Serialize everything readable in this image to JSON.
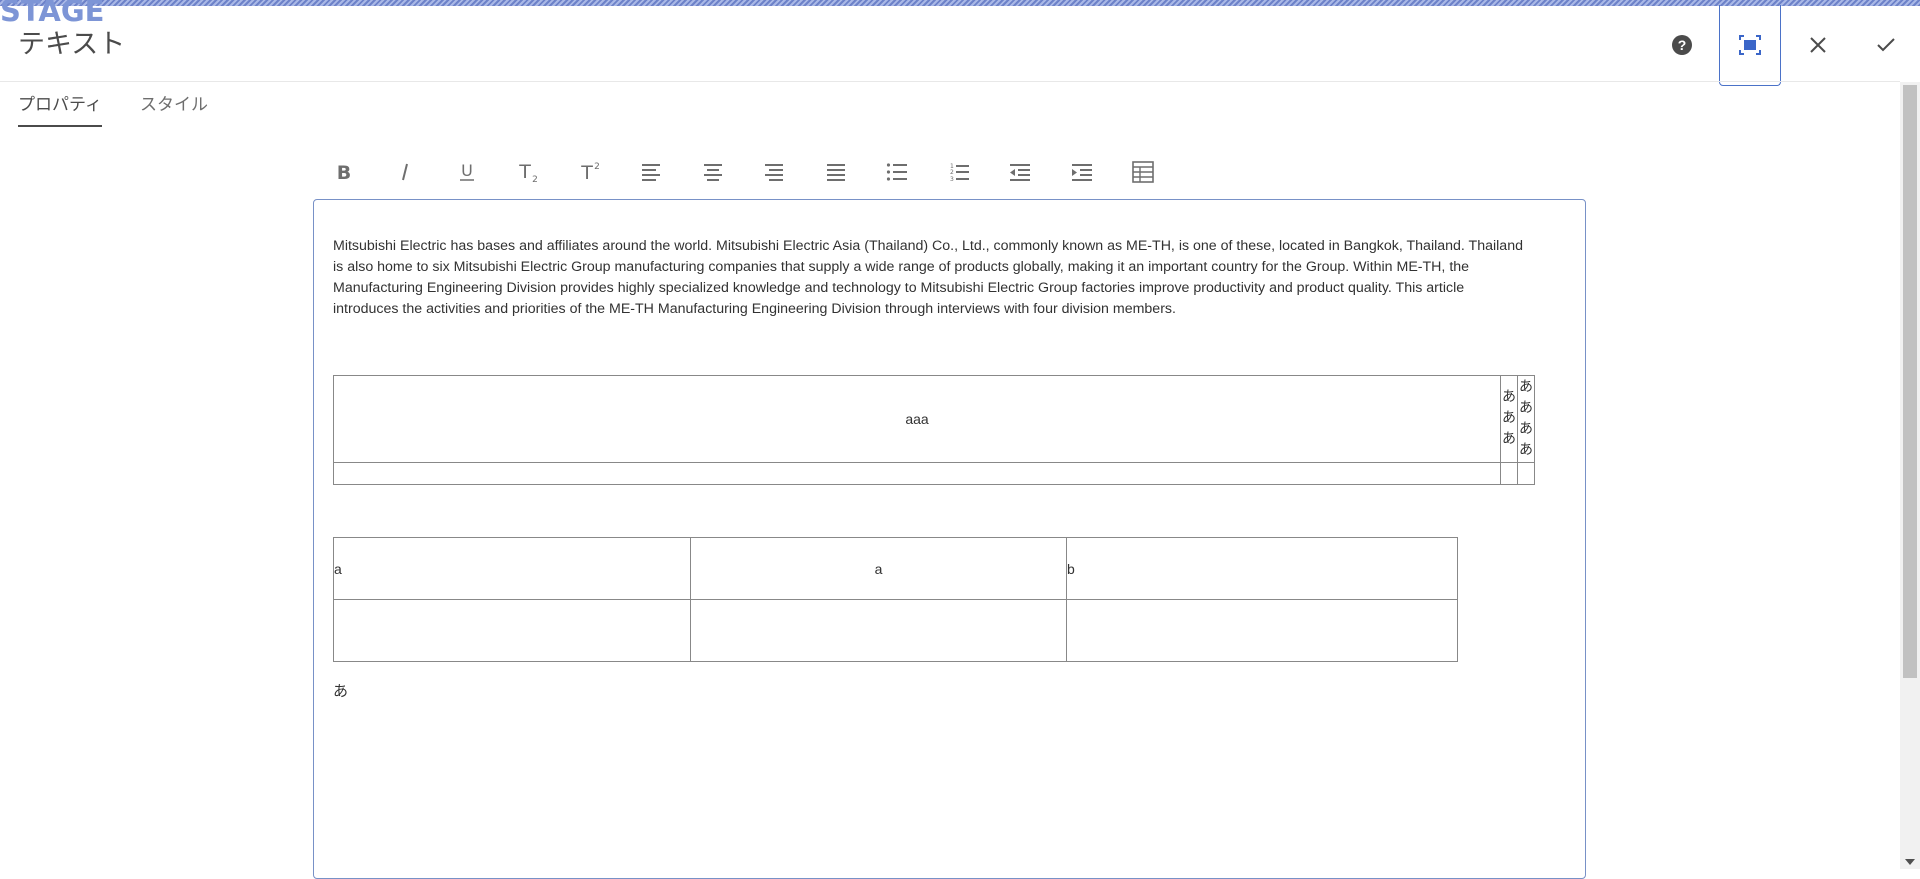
{
  "environment": {
    "label": "STAGE"
  },
  "dialog": {
    "title": "テキスト"
  },
  "header": {
    "help_icon": "help-circle-icon",
    "fullscreen_icon": "fullscreen-icon",
    "close_icon": "close-icon",
    "done_icon": "checkmark-icon"
  },
  "tabs": [
    {
      "label": "プロパティ",
      "selected": true
    },
    {
      "label": "スタイル",
      "selected": false
    }
  ],
  "toolbar": {
    "items": [
      "bold-icon",
      "italic-icon",
      "underline-icon",
      "subscript-icon",
      "superscript-icon",
      "align-left-icon",
      "align-center-icon",
      "align-right-icon",
      "justify-icon",
      "bulleted-list-icon",
      "numbered-list-icon",
      "outdent-icon",
      "indent-icon",
      "table-icon"
    ]
  },
  "editor": {
    "paragraph": "Mitsubishi Electric has bases and affiliates around the world. Mitsubishi Electric Asia (Thailand) Co., Ltd., commonly known as ME-TH, is one of these, located in Bangkok, Thailand. Thailand is also home to six Mitsubishi Electric Group manufacturing companies that supply a wide range of products globally, making it an important country for the Group. Within ME-TH, the Manufacturing Engineering Division provides highly specialized knowledge and technology to Mitsubishi Electric Group factories improve productivity and product quality. This article introduces the activities and priorities of the ME-TH Manufacturing Engineering Division through interviews with four division members.",
    "table1": {
      "main_cell": "aaa",
      "col2_text": [
        "あ",
        "あ",
        "あ"
      ],
      "col3_text": [
        "あ",
        "あ",
        "あ",
        "あ"
      ]
    },
    "table2": {
      "rows": [
        [
          "a",
          "a",
          "b"
        ],
        [
          "",
          "",
          ""
        ]
      ]
    },
    "trailing_text": "あ"
  },
  "colors": {
    "accent": "#4b72c8",
    "stage": "#7d95d6",
    "text": "#323232"
  }
}
